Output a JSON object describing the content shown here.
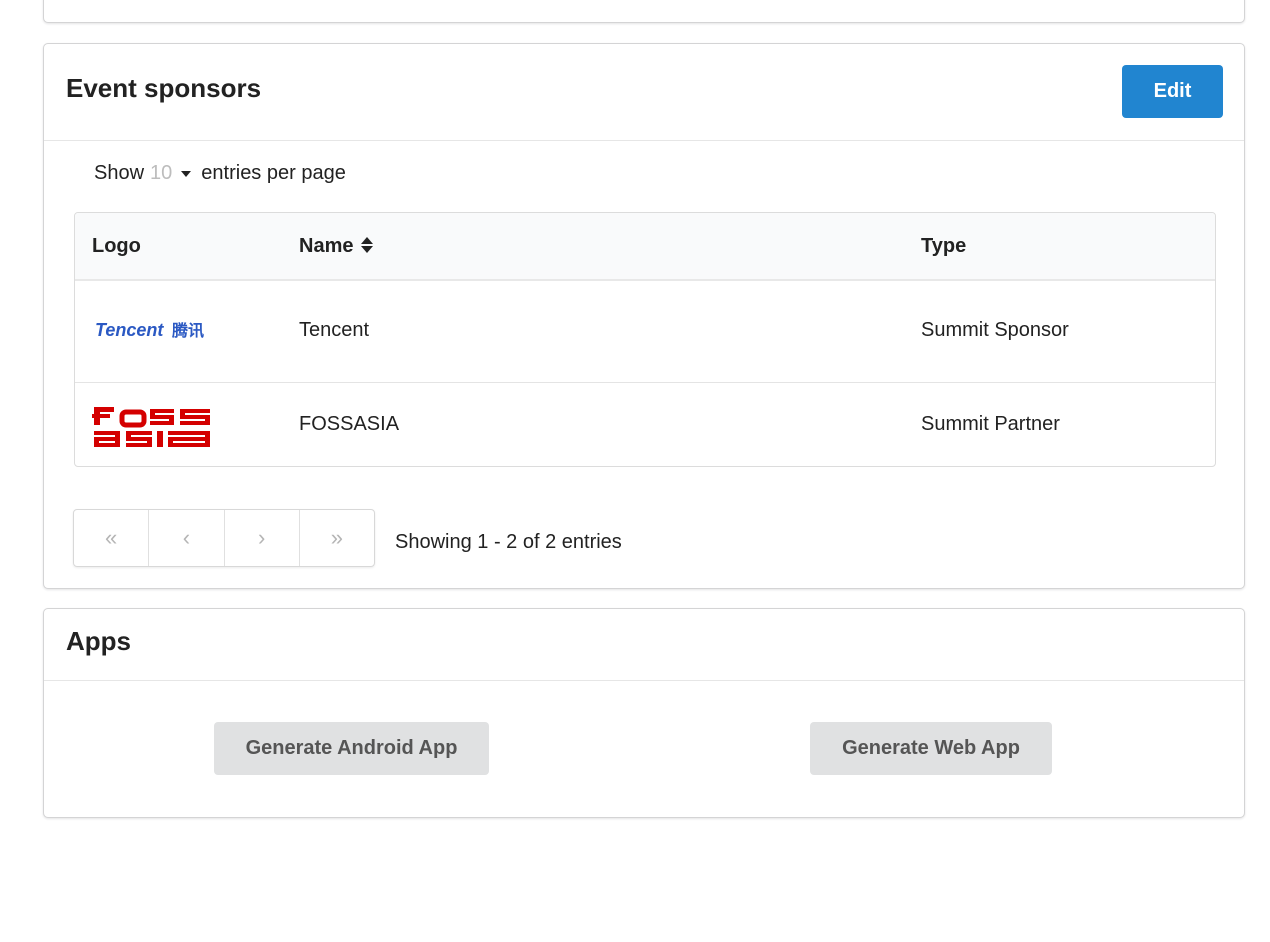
{
  "sponsors": {
    "title": "Event sponsors",
    "edit_label": "Edit",
    "per_page": {
      "show": "Show",
      "value": "10",
      "suffix": "entries per page"
    },
    "columns": {
      "logo": "Logo",
      "name": "Name",
      "type": "Type"
    },
    "rows": [
      {
        "logo_icon": "tencent-logo",
        "logo_text": "Tencent腾讯",
        "name": "Tencent",
        "type": "Summit Sponsor"
      },
      {
        "logo_icon": "fossasia-logo",
        "logo_text": "foss asia",
        "name": "FOSSASIA",
        "type": "Summit Partner"
      }
    ],
    "pagination": {
      "first": "«",
      "prev": "‹",
      "next": "›",
      "last": "»",
      "info": "Showing 1 - 2 of 2 entries"
    }
  },
  "apps": {
    "title": "Apps",
    "android_label": "Generate Android App",
    "web_label": "Generate Web App"
  },
  "colors": {
    "primary": "#2185d0",
    "secondary_button": "#e0e1e2",
    "tencent_blue": "#2b59c3",
    "fossasia_red": "#d40000"
  }
}
